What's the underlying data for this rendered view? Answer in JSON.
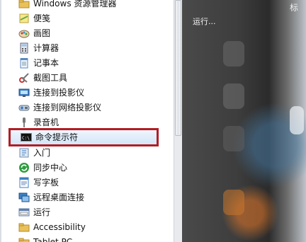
{
  "menu": {
    "items": [
      {
        "label": "Windows 资源管理器",
        "icon": "folder-explorer-icon"
      },
      {
        "label": "便笺",
        "icon": "sticky-notes-icon"
      },
      {
        "label": "画图",
        "icon": "paint-icon"
      },
      {
        "label": "计算器",
        "icon": "calculator-icon"
      },
      {
        "label": "记事本",
        "icon": "notepad-icon"
      },
      {
        "label": "截图工具",
        "icon": "snipping-tool-icon"
      },
      {
        "label": "连接到投影仪",
        "icon": "projector-icon"
      },
      {
        "label": "连接到网络投影仪",
        "icon": "network-projector-icon"
      },
      {
        "label": "录音机",
        "icon": "microphone-icon"
      },
      {
        "label": "命令提示符",
        "icon": "command-prompt-icon",
        "selected": true
      },
      {
        "label": "入门",
        "icon": "getting-started-icon"
      },
      {
        "label": "同步中心",
        "icon": "sync-icon"
      },
      {
        "label": "写字板",
        "icon": "wordpad-icon"
      },
      {
        "label": "远程桌面连接",
        "icon": "remote-desktop-icon"
      },
      {
        "label": "运行",
        "icon": "run-icon"
      },
      {
        "label": "Accessibility",
        "icon": "folder-icon"
      },
      {
        "label": "Tablet PC",
        "icon": "folder-icon"
      }
    ]
  },
  "desktop": {
    "run_label": "运行...",
    "corner_label": "标"
  },
  "colors": {
    "highlight_border": "#b21d24",
    "folder": "#e8c15a"
  }
}
